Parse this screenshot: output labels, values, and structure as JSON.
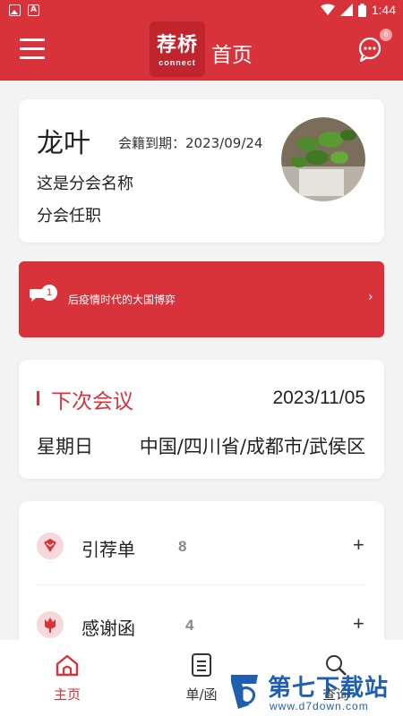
{
  "status_bar": {
    "time": "1:44",
    "left_icons": [
      "image-icon",
      "a-icon"
    ],
    "right_icons": [
      "wifi-icon",
      "signal-icon",
      "battery-icon"
    ]
  },
  "header": {
    "logo_cn": "荐桥",
    "logo_en": "connect",
    "title": "首页",
    "message_badge": "6",
    "brand_color": "#d8323a"
  },
  "member": {
    "name": "龙叶",
    "membership_expiry": "会籍到期：2023/09/24",
    "branch_name": "这是分会名称",
    "branch_position": "分会任职"
  },
  "notice": {
    "badge": "1",
    "text": "后疫情时代的大国博弈",
    "arrow": "›"
  },
  "next_meeting": {
    "title": "下次会议",
    "date": "2023/11/05",
    "weekday": "星期日",
    "location": "中国/四川省/成都市/武侯区"
  },
  "lists": [
    {
      "label": "引荐单",
      "count": "8",
      "icon": "referral-icon",
      "plus": "+"
    },
    {
      "label": "感谢函",
      "count": "4",
      "icon": "thanks-icon",
      "plus": "+"
    }
  ],
  "bottom_nav": [
    {
      "label": "主页",
      "icon": "home-icon",
      "active": true
    },
    {
      "label": "单/函",
      "icon": "document-icon",
      "active": false
    },
    {
      "label": "查询",
      "icon": "search-icon",
      "active": false
    }
  ],
  "watermark": {
    "title": "第七下载站",
    "url": "www.d7down.com"
  }
}
